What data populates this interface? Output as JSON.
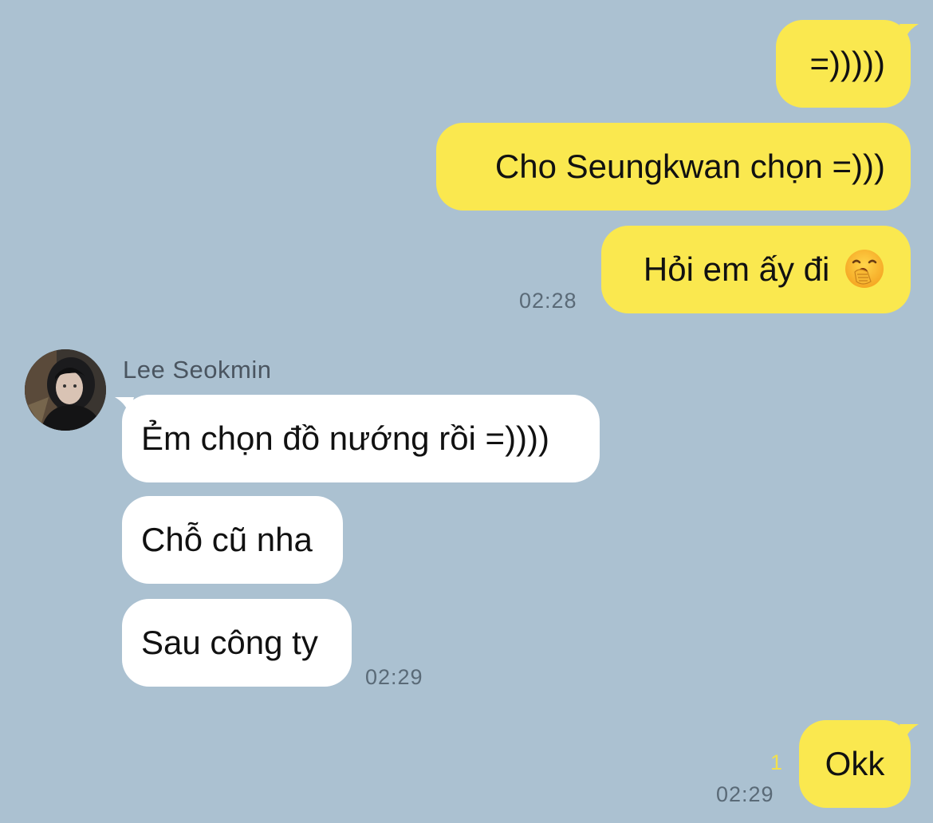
{
  "outgoing": [
    {
      "text": "=)))))"
    },
    {
      "text": "Cho Seungkwan chọn =)))"
    },
    {
      "text": "Hỏi em ấy đi",
      "icon": "yawning-face-icon",
      "time": "02:28"
    }
  ],
  "incoming": {
    "sender": "Lee Seokmin",
    "avatar_icon": "profile-photo",
    "messages": [
      {
        "text": "Ẻm chọn đồ nướng rồi =))))"
      },
      {
        "text": "Chỗ cũ nha"
      },
      {
        "text": "Sau công ty",
        "time": "02:29"
      }
    ]
  },
  "last_outgoing": {
    "text": "Okk",
    "unread_count": "1",
    "time": "02:29"
  },
  "colors": {
    "background": "#abc1d1",
    "outgoing_bubble": "#fae84f",
    "incoming_bubble": "#ffffff",
    "timestamp": "#5a6a77",
    "unread": "#f2e04d"
  }
}
